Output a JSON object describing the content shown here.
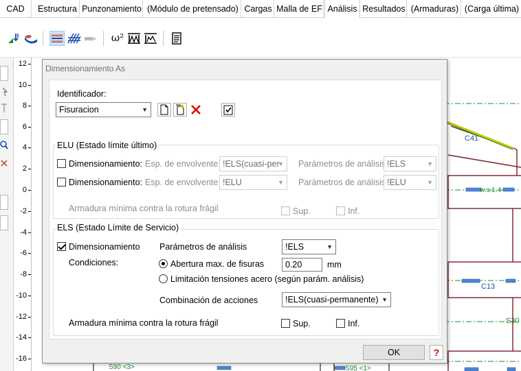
{
  "menu": {
    "tabs": [
      {
        "label": "CAD",
        "active": false
      },
      {
        "label": "Estructura",
        "active": false
      },
      {
        "label": "Punzonamiento",
        "active": false
      },
      {
        "label": "(Módulo de pretensado)",
        "active": false
      },
      {
        "label": "Cargas",
        "active": false
      },
      {
        "label": "Malla de EF",
        "active": false
      },
      {
        "label": "Análisis",
        "active": true
      },
      {
        "label": "Resultados",
        "active": false
      },
      {
        "label": "(Armaduras)",
        "active": false
      },
      {
        "label": "(Carga última)",
        "active": false
      }
    ]
  },
  "toolbar": {
    "omega_label": "ω²"
  },
  "ruler": {
    "ticks": [
      "12",
      "10",
      "8",
      "6",
      "4",
      "2",
      "0",
      "-2",
      "-4",
      "-6",
      "-8",
      "-10",
      "-12",
      "-14",
      "-16"
    ]
  },
  "canvas": {
    "labels": {
      "c41": "C41",
      "c13": "C13",
      "s30": "S30",
      "ws14": "w.s.1.4",
      "s90": "S90 <3>",
      "s95": "S95 <1>"
    }
  },
  "dialog": {
    "title": "Dimensionamiento As",
    "identifier": {
      "label": "Identificador:",
      "value": "Fisuracion"
    },
    "elu": {
      "title": "ELU (Estado límite último)",
      "rows": [
        {
          "label": "Dimensionamiento:",
          "checked": false,
          "env_label": "Esp. de envolvente",
          "env_value": "!ELS(cuasi-per",
          "params_label": "Parámetros de análisis",
          "params_value": "!ELS"
        },
        {
          "label": "Dimensionamiento:",
          "checked": false,
          "env_label": "Esp. de envolvente",
          "env_value": "!ELU",
          "params_label": "Parámetros de análisis",
          "params_value": "!ELU"
        }
      ],
      "min_reinf_label": "Armadura mínima contra la rotura frágil",
      "sup_label": "Sup.",
      "inf_label": "Inf."
    },
    "els": {
      "title": "ELS (Estado Límite de Servicio)",
      "dim_label": "Dimensionamiento",
      "dim_checked": true,
      "params_label": "Parámetros de análisis",
      "params_value": "!ELS",
      "conditions_label": "Condiciones:",
      "crack_label": "Abertura max. de fisuras",
      "crack_value": "0.20",
      "crack_unit": "mm",
      "steel_label": "Limitación tensiones acero (según parám. análisis)",
      "selected_condition": "crack",
      "combo_label": "Combinación de acciones",
      "combo_value": "!ELS(cuasi-permanente)",
      "min_reinf_label": "Armadura mínima contra la rotura frágil",
      "sup_label": "Sup.",
      "inf_label": "Inf."
    },
    "ok_label": "OK",
    "help_label": "?"
  },
  "colors": {
    "accent": "#0078d7",
    "beam": "#7a1f2b",
    "axis": "#1a8a2a",
    "label_blue": "#1e4fa8",
    "delete_red": "#e00000"
  }
}
